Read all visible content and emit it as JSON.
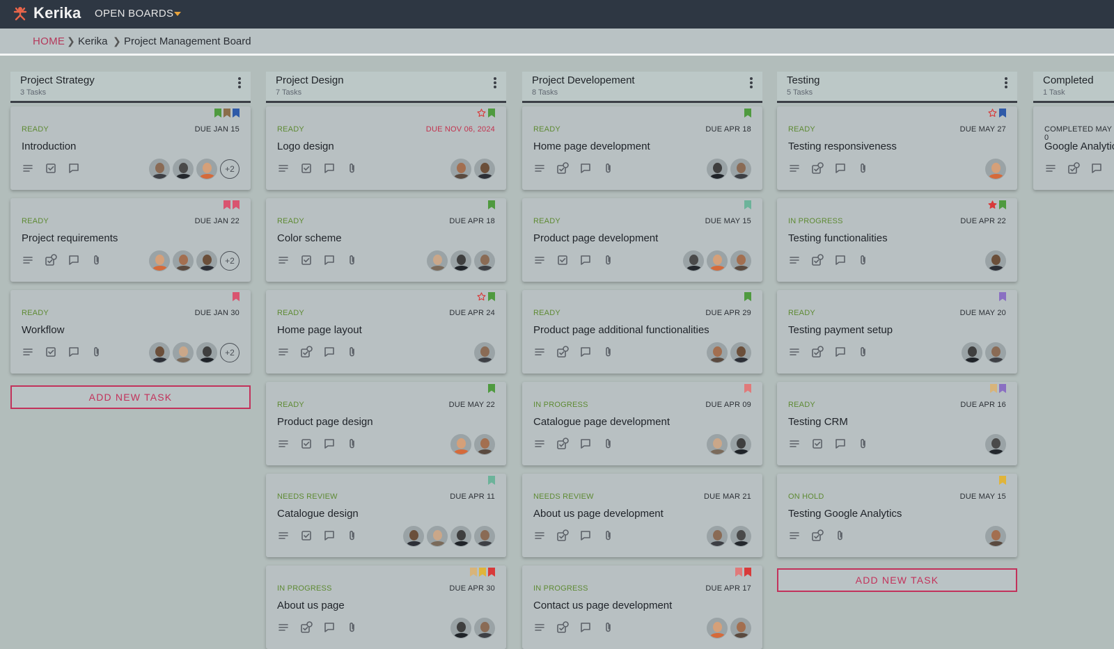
{
  "app": {
    "logo_text": "Kerika",
    "open_boards_label": "OPEN BOARDS"
  },
  "breadcrumb": {
    "home": "HOME",
    "account": "Kerika",
    "board": "Project Management Board"
  },
  "actions": {
    "add_task": "ADD NEW TASK"
  },
  "colors": {
    "accent": "#c2325b",
    "topbar": "#2e3743",
    "ready_status": "#5e8a33",
    "due_overdue": "#c2324e"
  },
  "columns": [
    {
      "title": "Project Strategy",
      "count": "3 Tasks",
      "cards": [
        {
          "status": "READY",
          "due": "DUE JAN 15",
          "title": "Introduction",
          "flags": [
            "bookmark-green",
            "bookmark-brown",
            "bookmark-blue"
          ],
          "icons": [
            "description-icon",
            "checklist-icon",
            "chat-icon"
          ],
          "avatars": 3,
          "more": "+2"
        },
        {
          "status": "READY",
          "due": "DUE JAN 22",
          "title": "Project requirements",
          "flags": [
            "bookmark-pink",
            "bookmark-pink"
          ],
          "icons": [
            "description-icon",
            "checklist-count-icon",
            "chat-icon",
            "attachment-icon"
          ],
          "avatars": 3,
          "more": "+2"
        },
        {
          "status": "READY",
          "due": "DUE JAN 30",
          "title": "Workflow",
          "flags": [
            "bookmark-pink"
          ],
          "icons": [
            "description-icon",
            "checklist-icon",
            "chat-icon",
            "attachment-icon"
          ],
          "avatars": 3,
          "more": "+2"
        }
      ]
    },
    {
      "title": "Project Design",
      "count": "7 Tasks",
      "cards": [
        {
          "status": "READY",
          "due": "DUE NOV 06, 2024",
          "overdue": true,
          "title": "Logo design",
          "flags": [
            "star-outline",
            "bookmark-green"
          ],
          "icons": [
            "description-icon",
            "checklist-icon",
            "chat-icon",
            "attachment-icon"
          ],
          "avatars": 2
        },
        {
          "status": "READY",
          "due": "DUE APR 18",
          "title": "Color scheme",
          "flags": [
            "bookmark-green"
          ],
          "icons": [
            "description-icon",
            "checklist-icon",
            "chat-icon",
            "attachment-icon"
          ],
          "avatars": 3
        },
        {
          "status": "READY",
          "due": "DUE APR 24",
          "title": "Home page layout",
          "flags": [
            "star-outline",
            "bookmark-green"
          ],
          "icons": [
            "description-icon",
            "checklist-count-icon",
            "chat-icon",
            "attachment-icon"
          ],
          "avatars": 1
        },
        {
          "status": "READY",
          "due": "DUE MAY 22",
          "title": "Product page design",
          "flags": [
            "bookmark-green"
          ],
          "icons": [
            "description-icon",
            "checklist-icon",
            "chat-icon",
            "attachment-icon"
          ],
          "avatars": 2
        },
        {
          "status": "NEEDS REVIEW",
          "due": "DUE APR 11",
          "title": "Catalogue design",
          "flags": [
            "bookmark-teal"
          ],
          "icons": [
            "description-icon",
            "checklist-icon",
            "chat-icon",
            "attachment-icon"
          ],
          "avatars": 4
        },
        {
          "status": "IN PROGRESS",
          "due": "DUE APR 30",
          "title": "About us page",
          "flags": [
            "bookmark-tan",
            "bookmark-yellow",
            "bookmark-red"
          ],
          "icons": [
            "description-icon",
            "checklist-count-icon",
            "chat-icon",
            "attachment-icon"
          ],
          "avatars": 2
        }
      ]
    },
    {
      "title": "Project Developement",
      "count": "8 Tasks",
      "cards": [
        {
          "status": "READY",
          "due": "DUE APR 18",
          "title": "Home page development",
          "flags": [
            "bookmark-green"
          ],
          "icons": [
            "description-icon",
            "checklist-count-icon",
            "chat-icon",
            "attachment-icon"
          ],
          "avatars": 2
        },
        {
          "status": "READY",
          "due": "DUE MAY 15",
          "title": "Product page development",
          "flags": [
            "bookmark-teal"
          ],
          "icons": [
            "description-icon",
            "checklist-icon",
            "chat-icon",
            "attachment-icon"
          ],
          "avatars": 3
        },
        {
          "status": "READY",
          "due": "DUE APR 29",
          "title": "Product page additional functionalities",
          "flags": [
            "bookmark-green"
          ],
          "icons": [
            "description-icon",
            "checklist-count-icon",
            "chat-icon",
            "attachment-icon"
          ],
          "avatars": 2
        },
        {
          "status": "IN PROGRESS",
          "due": "DUE APR 09",
          "title": "Catalogue page development",
          "flags": [
            "bookmark-salmon"
          ],
          "icons": [
            "description-icon",
            "checklist-count-icon",
            "chat-icon",
            "attachment-icon"
          ],
          "avatars": 2
        },
        {
          "status": "NEEDS REVIEW",
          "due": "DUE MAR 21",
          "title": "About us page development",
          "flags": [],
          "icons": [
            "description-icon",
            "checklist-count-icon",
            "chat-icon",
            "attachment-icon"
          ],
          "avatars": 2
        },
        {
          "status": "IN PROGRESS",
          "due": "DUE APR 17",
          "title": "Contact us page development",
          "flags": [
            "bookmark-salmon",
            "bookmark-red"
          ],
          "icons": [
            "description-icon",
            "checklist-count-icon",
            "chat-icon",
            "attachment-icon"
          ],
          "avatars": 2
        }
      ]
    },
    {
      "title": "Testing",
      "count": "5 Tasks",
      "cards": [
        {
          "status": "READY",
          "due": "DUE MAY 27",
          "title": "Testing responsiveness",
          "flags": [
            "star-outline",
            "bookmark-blue"
          ],
          "icons": [
            "description-icon",
            "checklist-count-icon",
            "chat-icon",
            "attachment-icon"
          ],
          "avatars": 1
        },
        {
          "status": "IN PROGRESS",
          "due": "DUE APR 22",
          "title": "Testing functionalities",
          "flags": [
            "star-filled",
            "bookmark-green"
          ],
          "icons": [
            "description-icon",
            "checklist-count-icon",
            "chat-icon",
            "attachment-icon"
          ],
          "avatars": 1
        },
        {
          "status": "READY",
          "due": "DUE MAY 20",
          "title": "Testing payment setup",
          "flags": [
            "bookmark-purple"
          ],
          "icons": [
            "description-icon",
            "checklist-count-icon",
            "chat-icon",
            "attachment-icon"
          ],
          "avatars": 2
        },
        {
          "status": "READY",
          "due": "DUE APR 16",
          "title": "Testing CRM",
          "flags": [
            "bookmark-tan",
            "bookmark-purple"
          ],
          "icons": [
            "description-icon",
            "checklist-icon",
            "chat-icon",
            "attachment-icon"
          ],
          "avatars": 1
        },
        {
          "status": "ON HOLD",
          "due": "DUE MAY 15",
          "title": "Testing Google Analytics",
          "flags": [
            "bookmark-yellow"
          ],
          "icons": [
            "description-icon",
            "checklist-count-icon",
            "attachment-icon"
          ],
          "avatars": 1
        }
      ]
    },
    {
      "title": "Completed",
      "count": "1 Task",
      "cards": [
        {
          "status": "COMPLETED MAY 0",
          "due": "",
          "title": "Google Analytic",
          "flags": [],
          "icons": [
            "description-icon",
            "checklist-count-icon",
            "chat-icon"
          ],
          "avatars": 0
        }
      ]
    }
  ]
}
